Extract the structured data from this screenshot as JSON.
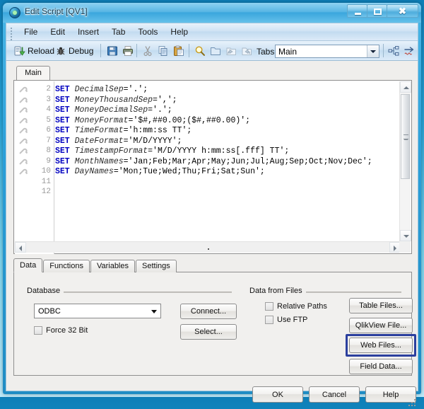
{
  "window": {
    "title": "Edit Script [QV1]",
    "icon": "qlikview-app-icon",
    "controls": {
      "minimize": "Minimize",
      "maximize": "Maximize",
      "close": "Close"
    }
  },
  "menubar": {
    "items": [
      {
        "label": "File"
      },
      {
        "label": "Edit"
      },
      {
        "label": "Insert"
      },
      {
        "label": "Tab"
      },
      {
        "label": "Tools"
      },
      {
        "label": "Help"
      }
    ]
  },
  "toolbar": {
    "reload_label": "Reload",
    "debug_label": "Debug",
    "icons": [
      {
        "name": "save-icon"
      },
      {
        "name": "print-icon"
      },
      {
        "name": "cut-icon"
      },
      {
        "name": "copy-icon"
      },
      {
        "name": "paste-icon"
      },
      {
        "name": "search-icon"
      },
      {
        "name": "open-folder-icon"
      },
      {
        "name": "undo-icon"
      },
      {
        "name": "redo-icon"
      }
    ],
    "tabs_label": "Tabs",
    "tabs_value": "Main",
    "right_icons": [
      {
        "name": "tab-organizer-icon"
      },
      {
        "name": "go-to-icon"
      }
    ]
  },
  "editor": {
    "tab_label": "Main",
    "gutter": [
      {
        "line": "2",
        "marker": true
      },
      {
        "line": "3",
        "marker": true
      },
      {
        "line": "4",
        "marker": true
      },
      {
        "line": "5",
        "marker": true
      },
      {
        "line": "6",
        "marker": true
      },
      {
        "line": "7",
        "marker": true
      },
      {
        "line": "8",
        "marker": true
      },
      {
        "line": "9",
        "marker": true
      },
      {
        "line": "10",
        "marker": true
      },
      {
        "line": "11",
        "marker": false
      },
      {
        "line": "12",
        "marker": false
      }
    ],
    "lines": [
      {
        "keyword": "SET",
        "variable": "DecimalSep",
        "rest": "='.';"
      },
      {
        "keyword": "SET",
        "variable": "MoneyThousandSep",
        "rest": "=',';"
      },
      {
        "keyword": "SET",
        "variable": "MoneyDecimalSep",
        "rest": "='.';"
      },
      {
        "keyword": "SET",
        "variable": "MoneyFormat",
        "rest": "='$#,##0.00;($#,##0.00)';"
      },
      {
        "keyword": "SET",
        "variable": "TimeFormat",
        "rest": "='h:mm:ss TT';"
      },
      {
        "keyword": "SET",
        "variable": "DateFormat",
        "rest": "='M/D/YYYY';"
      },
      {
        "keyword": "SET",
        "variable": "TimestampFormat",
        "rest": "='M/D/YYYY h:mm:ss[.fff] TT';"
      },
      {
        "keyword": "SET",
        "variable": "MonthNames",
        "rest": "='Jan;Feb;Mar;Apr;May;Jun;Jul;Aug;Sep;Oct;Nov;Dec';"
      },
      {
        "keyword": "SET",
        "variable": "DayNames",
        "rest": "='Mon;Tue;Wed;Thu;Fri;Sat;Sun';"
      }
    ]
  },
  "lower_panel": {
    "tabs": [
      {
        "label": "Data",
        "active": true
      },
      {
        "label": "Functions",
        "active": false
      },
      {
        "label": "Variables",
        "active": false
      },
      {
        "label": "Settings",
        "active": false
      }
    ],
    "database": {
      "group_label": "Database",
      "source_value": "ODBC",
      "force32_label": "Force 32 Bit",
      "force32_checked": false,
      "connect_label": "Connect...",
      "select_label": "Select..."
    },
    "data_from_files": {
      "group_label": "Data from Files",
      "relative_paths_label": "Relative Paths",
      "relative_paths_checked": false,
      "use_ftp_label": "Use FTP",
      "use_ftp_checked": false,
      "buttons": [
        {
          "label": "Table Files...",
          "focused": false
        },
        {
          "label": "QlikView File...",
          "focused": false
        },
        {
          "label": "Web Files...",
          "focused": true
        },
        {
          "label": "Field Data...",
          "focused": false
        }
      ]
    }
  },
  "footer": {
    "ok_label": "OK",
    "cancel_label": "Cancel",
    "help_label": "Help"
  },
  "colors": {
    "focus_highlight": "#2b3f9e",
    "keyword": "#0000c0",
    "aero_blue": "#3ba6dd",
    "panel_bg": "#f1f0ee"
  }
}
